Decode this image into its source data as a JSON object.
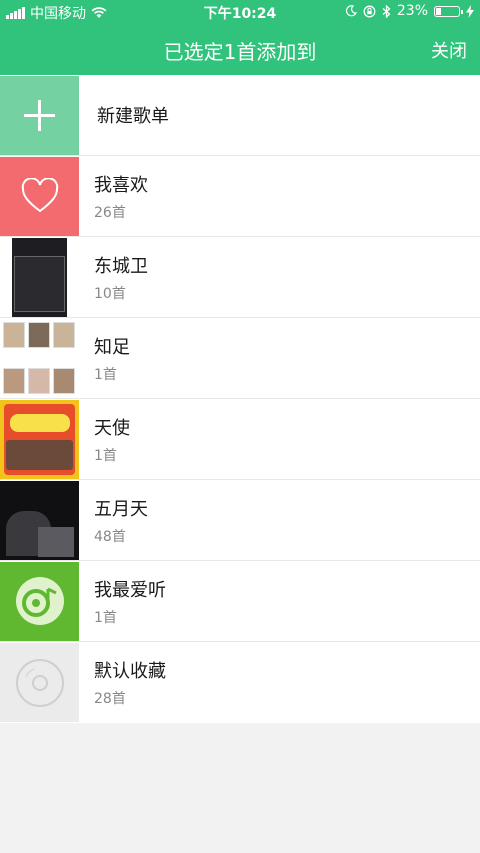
{
  "status_bar": {
    "carrier": "中国移动",
    "time": "下午10:24",
    "battery_text": "23%",
    "battery_level": 0.23
  },
  "header": {
    "title": "已选定1首添加到",
    "close_label": "关闭",
    "bg_color": "#31c27c"
  },
  "new_playlist_label": "新建歌单",
  "playlists": [
    {
      "name": "我喜欢",
      "count": "26首"
    },
    {
      "name": "东城卫",
      "count": "10首"
    },
    {
      "name": "知足",
      "count": "1首"
    },
    {
      "name": "天使",
      "count": "1首"
    },
    {
      "name": "五月天",
      "count": "48首"
    },
    {
      "name": "我最爱听",
      "count": "1首"
    },
    {
      "name": "默认收藏",
      "count": "28首"
    }
  ],
  "icons": {
    "signal": "signal-icon",
    "wifi": "wifi-icon",
    "moon": "moon-icon",
    "lock_rotation": "rotation-lock-icon",
    "bluetooth": "bluetooth-icon",
    "battery": "battery-icon",
    "charging": "charging-icon",
    "add": "plus-icon",
    "heart": "heart-icon",
    "disc": "disc-icon",
    "music_disc": "music-disc-icon"
  }
}
